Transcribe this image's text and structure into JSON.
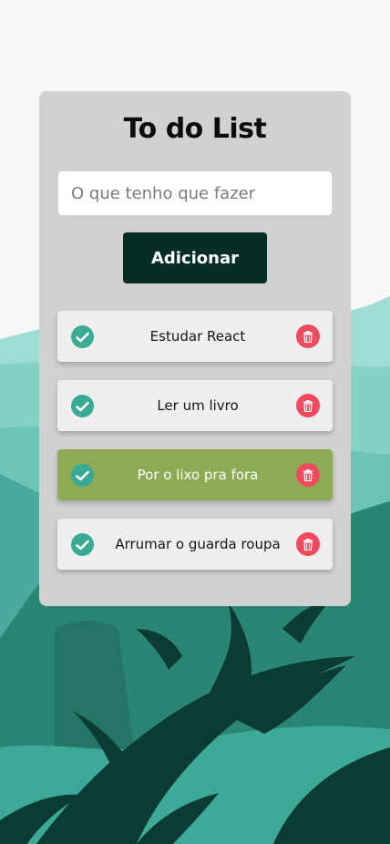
{
  "title": "To do List",
  "input": {
    "placeholder": "O que tenho que fazer",
    "value": ""
  },
  "add_button": {
    "label": "Adicionar"
  },
  "tasks": [
    {
      "label": "Estudar React",
      "done": false
    },
    {
      "label": "Ler um livro",
      "done": false
    },
    {
      "label": "Por o lixo pra fora",
      "done": true
    },
    {
      "label": "Arrumar o guarda roupa",
      "done": false
    }
  ],
  "icons": {
    "complete": "check-circle-icon",
    "delete": "trash-icon"
  },
  "colors": {
    "card_bg": "#d1d1d1",
    "button_bg": "#032d25",
    "check": "#39ab95",
    "delete": "#ef4a5d",
    "done_item": "#8dab55"
  }
}
